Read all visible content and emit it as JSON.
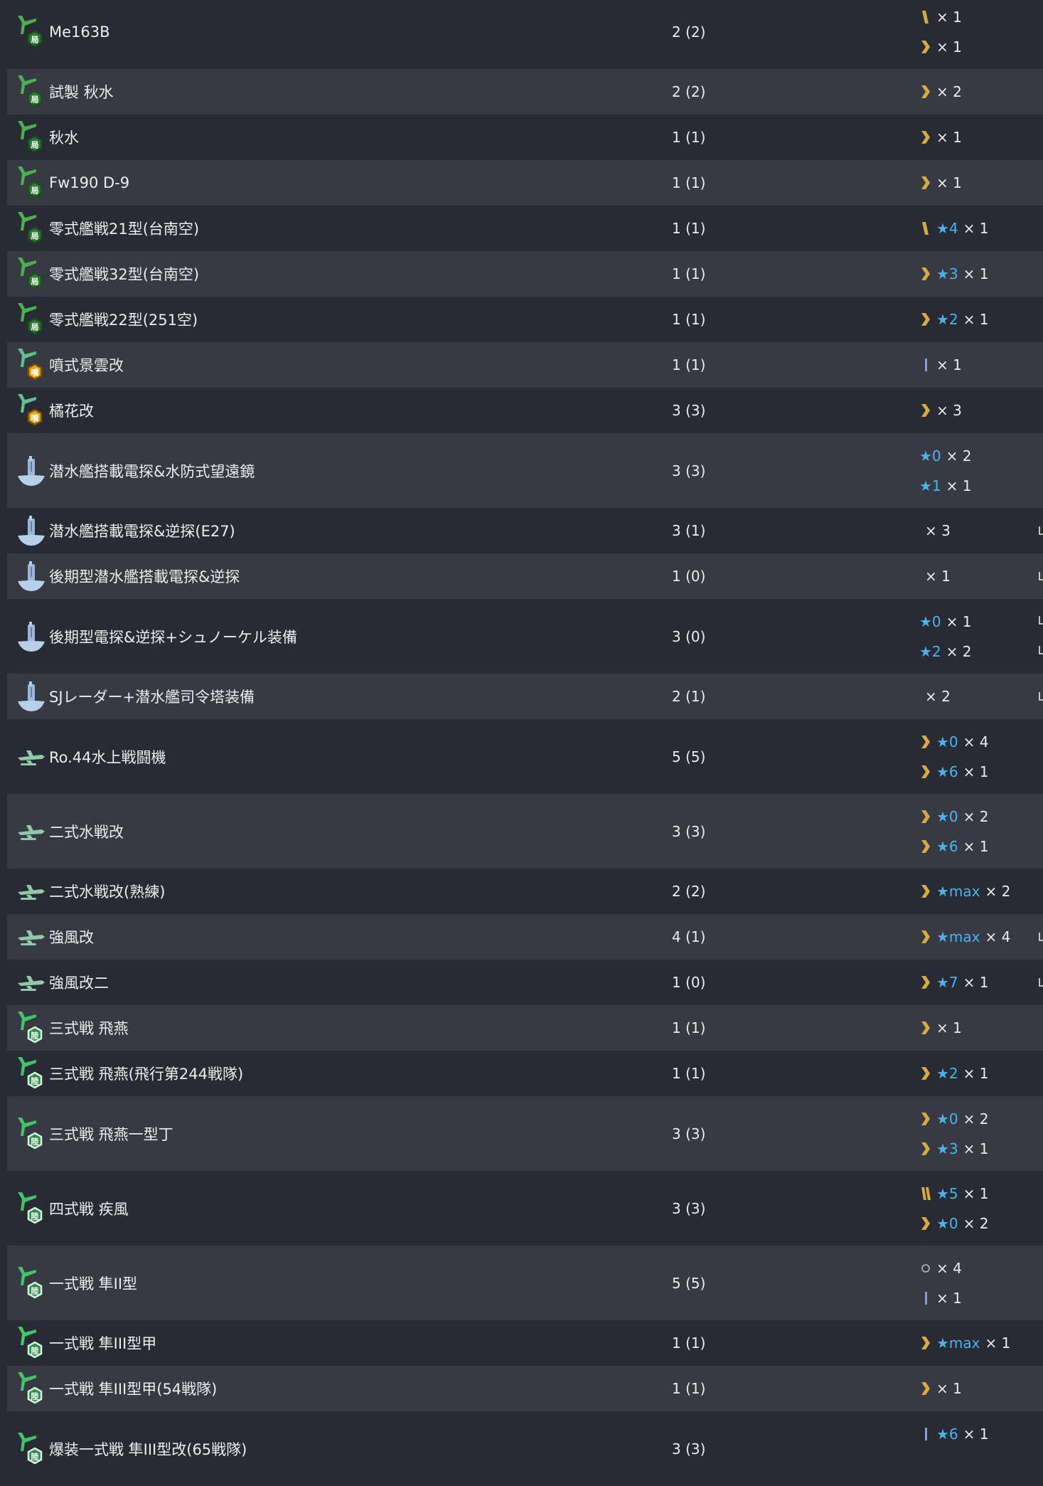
{
  "colors": {
    "background": "#282b33",
    "row_alt": "#373a42",
    "text": "#ececee",
    "star": "#4db2ec",
    "chevron": "#d8a93e"
  },
  "rows": [
    {
      "icon": "army-fighter-icon-kyoku",
      "name": "Me163B",
      "count": "2 (2)",
      "prof": [
        {
          "pi": "slash-1-icon",
          "star": "",
          "mult": "× 1"
        },
        {
          "pi": "chevron-icon",
          "star": "",
          "mult": "× 1"
        }
      ]
    },
    {
      "icon": "army-fighter-icon-kyoku",
      "name": "試製 秋水",
      "count": "2 (2)",
      "prof": [
        {
          "pi": "chevron-icon",
          "star": "",
          "mult": "× 2"
        }
      ]
    },
    {
      "icon": "army-fighter-icon-kyoku",
      "name": "秋水",
      "count": "1 (1)",
      "prof": [
        {
          "pi": "chevron-icon",
          "star": "",
          "mult": "× 1"
        }
      ]
    },
    {
      "icon": "army-fighter-icon-kyoku",
      "name": "Fw190 D-9",
      "count": "1 (1)",
      "prof": [
        {
          "pi": "chevron-icon",
          "star": "",
          "mult": "× 1"
        }
      ]
    },
    {
      "icon": "army-fighter-icon-kyoku",
      "name": "零式艦戦21型(台南空)",
      "count": "1 (1)",
      "prof": [
        {
          "pi": "slash-1-icon",
          "star": "★4",
          "mult": "× 1"
        }
      ]
    },
    {
      "icon": "army-fighter-icon-kyoku",
      "name": "零式艦戦32型(台南空)",
      "count": "1 (1)",
      "prof": [
        {
          "pi": "chevron-icon",
          "star": "★3",
          "mult": "× 1"
        }
      ]
    },
    {
      "icon": "army-fighter-icon-kyoku",
      "name": "零式艦戦22型(251空)",
      "count": "1 (1)",
      "prof": [
        {
          "pi": "chevron-icon",
          "star": "★2",
          "mult": "× 1"
        }
      ]
    },
    {
      "icon": "jet-fighter-icon-fun",
      "name": "噴式景雲改",
      "count": "1 (1)",
      "prof": [
        {
          "pi": "bar-icon",
          "star": "",
          "mult": "× 1"
        }
      ]
    },
    {
      "icon": "jet-fighter-icon-fun",
      "name": "橘花改",
      "count": "3 (3)",
      "prof": [
        {
          "pi": "chevron-icon",
          "star": "",
          "mult": "× 3"
        }
      ]
    },
    {
      "icon": "submarine-radar-icon",
      "name": "潜水艦搭載電探&水防式望遠鏡",
      "count": "3 (3)",
      "prof": [
        {
          "pi": "",
          "star": "★0",
          "mult": "× 2"
        },
        {
          "pi": "",
          "star": "★1",
          "mult": "× 1"
        }
      ]
    },
    {
      "icon": "submarine-radar-icon",
      "name": "潜水艦搭載電探&逆探(E27)",
      "count": "3 (1)",
      "lv": true,
      "prof": [
        {
          "pi": "",
          "star": "",
          "mult": "× 3"
        }
      ]
    },
    {
      "icon": "submarine-radar-icon",
      "name": "後期型潜水艦搭載電探&逆探",
      "count": "1 (0)",
      "lv": true,
      "prof": [
        {
          "pi": "",
          "star": "",
          "mult": "× 1"
        }
      ]
    },
    {
      "icon": "submarine-radar-icon",
      "name": "後期型電探&逆探+シュノーケル装備",
      "count": "3 (0)",
      "lv": true,
      "prof": [
        {
          "pi": "",
          "star": "★0",
          "mult": "× 1"
        },
        {
          "pi": "",
          "star": "★2",
          "mult": "× 2"
        }
      ]
    },
    {
      "icon": "submarine-radar-icon",
      "name": "SJレーダー+潜水艦司令塔装備",
      "count": "2 (1)",
      "lv": true,
      "prof": [
        {
          "pi": "",
          "star": "",
          "mult": "× 2"
        }
      ]
    },
    {
      "icon": "seaplane-fighter-icon",
      "name": "Ro.44水上戦闘機",
      "count": "5 (5)",
      "prof": [
        {
          "pi": "chevron-icon",
          "star": "★0",
          "mult": "× 4"
        },
        {
          "pi": "chevron-icon",
          "star": "★6",
          "mult": "× 1"
        }
      ]
    },
    {
      "icon": "seaplane-fighter-icon",
      "name": "二式水戦改",
      "count": "3 (3)",
      "prof": [
        {
          "pi": "chevron-icon",
          "star": "★0",
          "mult": "× 2"
        },
        {
          "pi": "chevron-icon",
          "star": "★6",
          "mult": "× 1"
        }
      ]
    },
    {
      "icon": "seaplane-fighter-icon",
      "name": "二式水戦改(熟練)",
      "count": "2 (2)",
      "prof": [
        {
          "pi": "chevron-icon",
          "star": "★max",
          "mult": "× 2"
        }
      ]
    },
    {
      "icon": "seaplane-fighter-icon",
      "name": "強風改",
      "count": "4 (1)",
      "lv": true,
      "prof": [
        {
          "pi": "chevron-icon",
          "star": "★max",
          "mult": "× 4"
        }
      ]
    },
    {
      "icon": "seaplane-fighter-icon",
      "name": "強風改二",
      "count": "1 (0)",
      "lv": true,
      "prof": [
        {
          "pi": "chevron-icon",
          "star": "★7",
          "mult": "× 1"
        }
      ]
    },
    {
      "icon": "army-fighter-icon-riku",
      "name": "三式戦 飛燕",
      "count": "1 (1)",
      "prof": [
        {
          "pi": "chevron-icon",
          "star": "",
          "mult": "× 1"
        }
      ]
    },
    {
      "icon": "army-fighter-icon-riku",
      "name": "三式戦 飛燕(飛行第244戦隊)",
      "count": "1 (1)",
      "prof": [
        {
          "pi": "chevron-icon",
          "star": "★2",
          "mult": "× 1"
        }
      ]
    },
    {
      "icon": "army-fighter-icon-riku",
      "name": "三式戦 飛燕一型丁",
      "count": "3 (3)",
      "prof": [
        {
          "pi": "chevron-icon",
          "star": "★0",
          "mult": "× 2"
        },
        {
          "pi": "chevron-icon",
          "star": "★3",
          "mult": "× 1"
        }
      ]
    },
    {
      "icon": "army-fighter-icon-riku",
      "name": "四式戦 疾風",
      "count": "3 (3)",
      "prof": [
        {
          "pi": "slash-2-icon",
          "star": "★5",
          "mult": "× 1"
        },
        {
          "pi": "chevron-icon",
          "star": "★0",
          "mult": "× 2"
        }
      ]
    },
    {
      "icon": "army-fighter-icon-riku",
      "name": "一式戦 隼II型",
      "count": "5 (5)",
      "prof": [
        {
          "pi": "circle-icon",
          "star": "",
          "mult": "× 4"
        },
        {
          "pi": "bar-icon",
          "star": "",
          "mult": "× 1"
        }
      ]
    },
    {
      "icon": "army-fighter-icon-riku",
      "name": "一式戦 隼III型甲",
      "count": "1 (1)",
      "prof": [
        {
          "pi": "chevron-icon",
          "star": "★max",
          "mult": "× 1"
        }
      ]
    },
    {
      "icon": "army-fighter-icon-riku",
      "name": "一式戦 隼III型甲(54戦隊)",
      "count": "1 (1)",
      "prof": [
        {
          "pi": "chevron-icon",
          "star": "",
          "mult": "× 1"
        }
      ]
    },
    {
      "icon": "army-fighter-icon-riku",
      "name": "爆装一式戦 隼III型改(65戦隊)",
      "count": "3 (3)",
      "prof": [
        {
          "pi": "bar-icon",
          "star": "★6",
          "mult": "× 1"
        },
        {
          "pi": "",
          "star": "",
          "mult": ""
        }
      ]
    }
  ]
}
